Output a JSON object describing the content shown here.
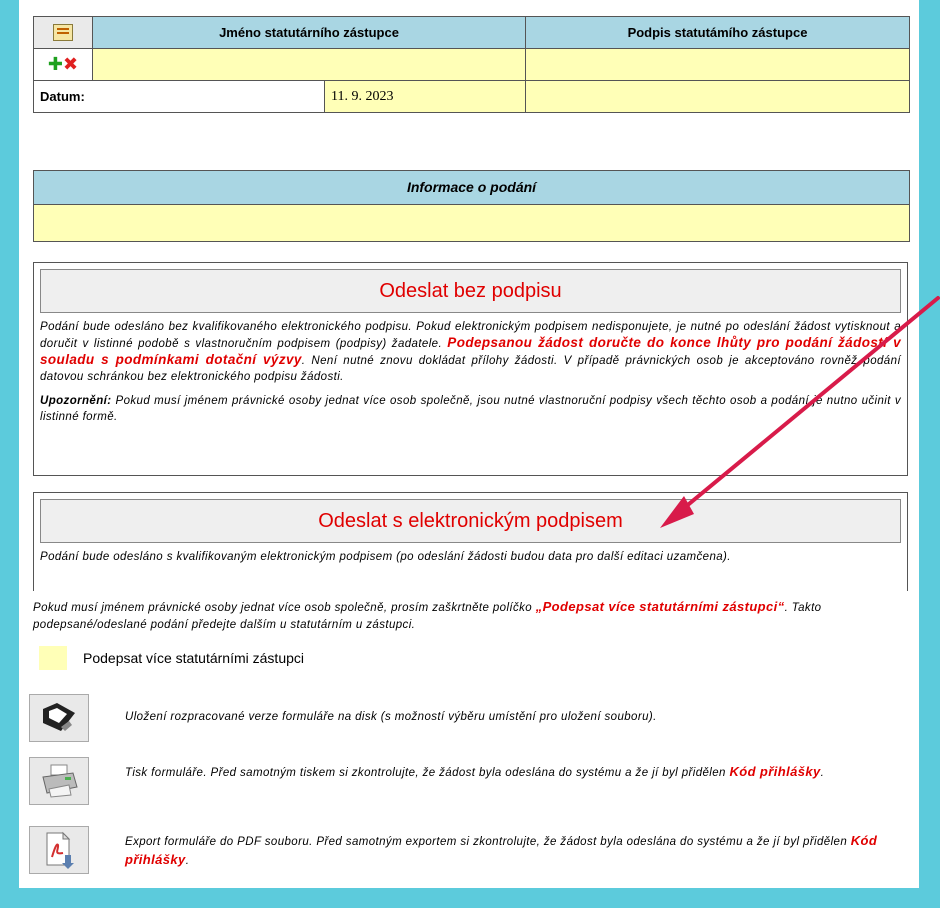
{
  "signature": {
    "col_name_header": "Jméno statutárního zástupce",
    "col_sign_header": "Podpis statutámího zástupce",
    "date_label": "Datum:",
    "date_value": "11. 9. 2023"
  },
  "info": {
    "header": "Informace o podání"
  },
  "unsigned": {
    "title": "Odeslat bez podpisu",
    "text_a": "Podání bude odesláno bez kvalifikovaného elektronického podpisu. Pokud elektronickým podpisem nedisponujete, je nutné po odeslání žádost vytisknout a doručit v listinné podobě s vlastnoručním podpisem (podpisy) žadatele. ",
    "text_red": "Podepsanou žádost doručte do konce lhůty pro podání žádostí v souladu s podmínkami dotační výzvy",
    "text_b": ". Není nutné znovu dokládat přílohy žádosti. V případě právnických osob je akceptováno rovněž podání datovou schránkou bez elektronického podpisu žádosti.",
    "note_label": "Upozornění:",
    "note_text": " Pokud musí jménem právnické osoby jednat více osob společně, jsou nutné vlastnoruční podpisy všech těchto osob a podání je nutno učinit v listinné formě."
  },
  "signed": {
    "title": "Odeslat s elektronickým podpisem",
    "text": "Podání bude odesláno s kvalifikovaným elektronickým podpisem (po odeslání žádosti budou data pro další editaci uzamčena)."
  },
  "multi": {
    "text_a": "Pokud musí jménem právnické osoby jednat více osob společně, prosím zaškrtněte políčko ",
    "text_red": "„Podepsat více statutárními zástupci“",
    "text_b": ". Takto podepsané/odeslané podání předejte dalším u statutárním u zástupci.",
    "checkbox_label": "Podepsat více statutárními zástupci"
  },
  "actions": {
    "save_text": "Uložení rozpracované verze formuláře na disk (s možností výběru umístění pro uložení souboru).",
    "print_text": "Tisk formuláře. Před samotným tiskem si zkontrolujte, že žádost byla odeslána do systému a že jí byl přidělen ",
    "print_red": "Kód přihlášky",
    "export_text": "Export formuláře do PDF souboru. Před samotným exportem si zkontrolujte, že žádost byla odeslána do systému a že jí byl přidělen ",
    "export_red": "Kód přihlášky",
    "period": "."
  },
  "colors": {
    "background": "#5ccbdc",
    "header_blue": "#a9d6e3",
    "input_yellow": "#ffffb7",
    "accent_red": "#e00000",
    "arrow": "#d81b4a"
  }
}
